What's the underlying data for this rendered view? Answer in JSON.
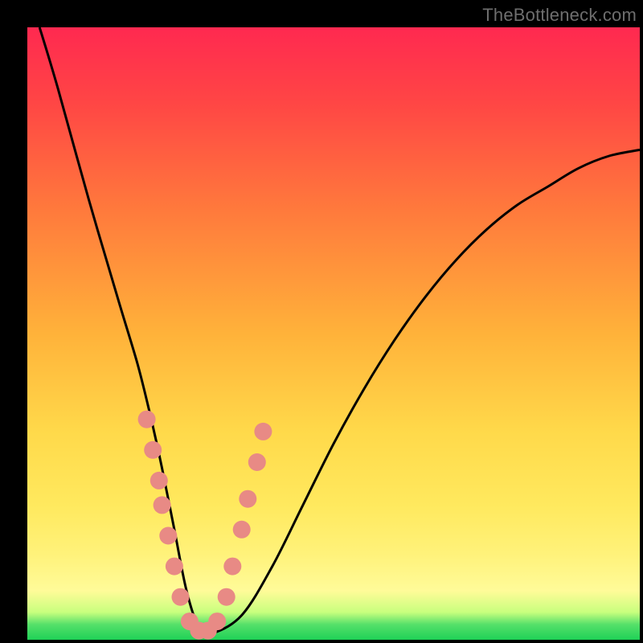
{
  "watermark": "TheBottleneck.com",
  "chart_data": {
    "type": "line",
    "title": "",
    "xlabel": "",
    "ylabel": "",
    "xlim": [
      0,
      100
    ],
    "ylim": [
      0,
      100
    ],
    "grid": false,
    "legend": false,
    "series": [
      {
        "name": "bottleneck-curve",
        "x": [
          2,
          5,
          10,
          15,
          18,
          20,
          22,
          24,
          26,
          28,
          30,
          35,
          40,
          45,
          50,
          55,
          60,
          65,
          70,
          75,
          80,
          85,
          90,
          95,
          100
        ],
        "y": [
          100,
          90,
          72,
          55,
          45,
          37,
          28,
          18,
          8,
          2,
          1,
          4,
          12,
          22,
          32,
          41,
          49,
          56,
          62,
          67,
          71,
          74,
          77,
          79,
          80
        ]
      }
    ],
    "points": {
      "name": "marker-dots",
      "coords": [
        [
          19.5,
          36
        ],
        [
          20.5,
          31
        ],
        [
          21.5,
          26
        ],
        [
          22.0,
          22
        ],
        [
          23.0,
          17
        ],
        [
          24.0,
          12
        ],
        [
          25.0,
          7
        ],
        [
          26.5,
          3
        ],
        [
          28.0,
          1.5
        ],
        [
          29.5,
          1.5
        ],
        [
          31.0,
          3
        ],
        [
          32.5,
          7
        ],
        [
          33.5,
          12
        ],
        [
          35.0,
          18
        ],
        [
          36.0,
          23
        ],
        [
          37.5,
          29
        ],
        [
          38.5,
          34
        ]
      ]
    },
    "colors": {
      "curve": "#000000",
      "dots": "#e88a85",
      "gradient_top": "#ff2950",
      "gradient_mid": "#ffd94a",
      "gradient_bottom": "#1fd157"
    }
  }
}
